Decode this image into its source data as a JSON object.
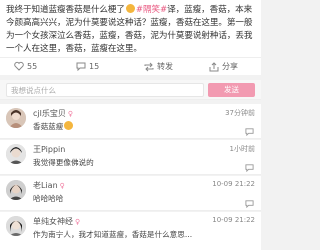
{
  "post": {
    "text_part1": "我终于知道蓝瘦香菇是什么梗了",
    "tag": "#隔笑#",
    "text_part2": "译，蓝瘦，香菇，本来今颜高高兴兴，泥为什莫要说这种话？蓝瘦，香菇在这里。第一般为一个女孩深泣么香菇，蓝瘦，香菇，泥为什莫要说射种话，丢我一个人在这里，香菇，蓝瘦在这里。"
  },
  "actions": {
    "like_count": "55",
    "comment_count": "15",
    "repost_label": "转发",
    "share_label": "分享"
  },
  "comment_box": {
    "placeholder": "我想说点什么",
    "send_label": "发送"
  },
  "comments": [
    {
      "name": "cjl乐宝贝",
      "gender": "♀",
      "text": "香菇蓝瘦",
      "time": "37分钟前"
    },
    {
      "name": "王Pippin",
      "gender": "",
      "text": "我觉得更像佛说的",
      "time": "1小时前"
    },
    {
      "name": "老Lian",
      "gender": "♀",
      "text": "哈哈哈哈",
      "time": "10-09 21:22"
    },
    {
      "name": "单纯女神经",
      "gender": "♀",
      "text": "作为南宁人，我才知道蓝瘦，香菇是什么意思...",
      "time": "10-09 21:22"
    }
  ],
  "colors": {
    "accent": "#e8557e",
    "send_button": "#f29ab1",
    "gender_female": "#f07ba0"
  },
  "icons": [
    "heart-icon",
    "comment-icon",
    "repost-icon",
    "share-icon",
    "reply-icon"
  ]
}
